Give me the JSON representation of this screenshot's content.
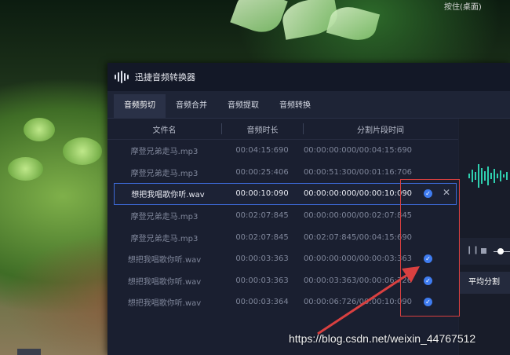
{
  "desktop": {
    "top_label": "按住(桌面)"
  },
  "app": {
    "title": "迅捷音频转换器",
    "tabs": [
      {
        "label": "音频剪切",
        "active": true
      },
      {
        "label": "音频合并",
        "active": false
      },
      {
        "label": "音频提取",
        "active": false
      },
      {
        "label": "音频转换",
        "active": false
      }
    ],
    "table": {
      "headers": [
        "文件名",
        "音频时长",
        "分割片段时间"
      ],
      "rows": [
        {
          "name": "摩登兄弟走马.mp3",
          "duration": "00:04:15:690",
          "segment": "00:00:00:000/00:04:15:690",
          "selected": false,
          "checked": false
        },
        {
          "name": "摩登兄弟走马.mp3",
          "duration": "00:00:25:406",
          "segment": "00:00:51:300/00:01:16:706",
          "selected": false,
          "checked": false
        },
        {
          "name": "想把我唱歌你听.wav",
          "duration": "00:00:10:090",
          "segment": "00:00:00:000/00:00:10:090",
          "selected": true,
          "checked": true
        },
        {
          "name": "摩登兄弟走马.mp3",
          "duration": "00:02:07:845",
          "segment": "00:00:00:000/00:02:07:845",
          "selected": false,
          "checked": false
        },
        {
          "name": "摩登兄弟走马.mp3",
          "duration": "00:02:07:845",
          "segment": "00:02:07:845/00:04:15:690",
          "selected": false,
          "checked": false
        },
        {
          "name": "想把我唱歌你听.wav",
          "duration": "00:00:03:363",
          "segment": "00:00:00:000/00:00:03:363",
          "selected": false,
          "checked": true
        },
        {
          "name": "想把我唱歌你听.wav",
          "duration": "00:00:03:363",
          "segment": "00:00:03:363/00:00:06:726",
          "selected": false,
          "checked": true
        },
        {
          "name": "想把我唱歌你听.wav",
          "duration": "00:00:03:364",
          "segment": "00:00:06:726/00:00:10:090",
          "selected": false,
          "checked": true
        }
      ]
    },
    "right_panel": {
      "split_tab_label": "平均分割"
    }
  },
  "icons": {
    "check": "check-circle-icon",
    "close": "close-icon",
    "pause": "pause-icon",
    "stop": "stop-icon"
  },
  "colors": {
    "accent": "#3f7cf0",
    "waveform": "#2fd1b0",
    "annotation": "#d94040"
  },
  "watermark": "https://blog.csdn.net/weixin_44767512"
}
